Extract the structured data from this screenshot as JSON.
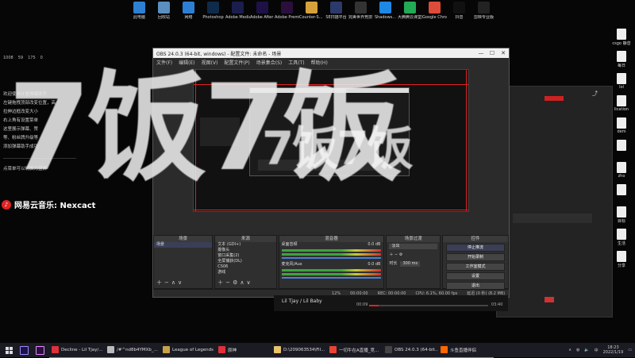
{
  "desktop_icons": [
    {
      "label": "此电脑",
      "icon": "computer-icon",
      "color": "#2d7fd3"
    },
    {
      "label": "回收站",
      "icon": "recycle-bin-icon",
      "color": "#5a8fbf"
    },
    {
      "label": "网络",
      "icon": "network-icon",
      "color": "#2d7fd3"
    },
    {
      "label": "Photoshop",
      "icon": "photoshop-icon",
      "color": "#0f2a4a"
    },
    {
      "label": "Adobe Media...",
      "icon": "media-encoder-icon",
      "color": "#1a1e4d"
    },
    {
      "label": "Adobe After Effects 2020",
      "icon": "after-effects-icon",
      "color": "#1d1147"
    },
    {
      "label": "Adobe Premie...",
      "icon": "premiere-icon",
      "color": "#2a0f3d"
    },
    {
      "label": "Counter-S... Global Off...",
      "icon": "csgo-icon",
      "color": "#d8a03c"
    },
    {
      "label": "SE扫描平台",
      "icon": "se-icon",
      "color": "#2b3a6b"
    },
    {
      "label": "完美世界竞技平台",
      "icon": "perfect-world-icon",
      "color": "#333333"
    },
    {
      "label": "Shadows...",
      "icon": "shadowsocks-icon",
      "color": "#1e88e5"
    },
    {
      "label": "大腾腾云课堂播放器",
      "icon": "player-icon",
      "color": "#22aa55"
    },
    {
      "label": "Google Chrome",
      "icon": "chrome-icon",
      "color": "#dd4b39"
    },
    {
      "label": "抖音",
      "icon": "douyin-icon",
      "color": "#111111"
    },
    {
      "label": "剪映专业版",
      "icon": "jianying-icon",
      "color": "#222222"
    }
  ],
  "right_icons": [
    {
      "label": "csgo 静音"
    },
    {
      "label": "每日"
    },
    {
      "label": "lol"
    },
    {
      "label": "lication"
    },
    {
      "label": "dem"
    },
    {
      "label": ""
    },
    {
      "label": "zho"
    },
    {
      "label": ""
    },
    {
      "label": "目标"
    },
    {
      "label": "生活"
    },
    {
      "label": "分享"
    }
  ],
  "chat": {
    "stats": [
      "1008",
      "59",
      "175",
      "0"
    ],
    "lines": [
      "欢迎使用斗鱼弹幕助手",
      "左键拖拽顶部改变位置，高",
      "拉伸边框改变大小",
      "右上角有设置菜单",
      "这里展示弹幕、赞",
      "等、粉丝牌升级等",
      "添加弹幕助手成功"
    ],
    "footer": "点菜单可以切换为竖屏"
  },
  "music_overlay": "网易云音乐: Nexcact",
  "overlay_text": [
    "7饭7饭",
    "7饭7饭"
  ],
  "obs": {
    "title": "OBS 24.0.3 (64-bit, windows) - 配置文件: 未命名 - 场景",
    "window_buttons": [
      "—",
      "☐",
      "✕"
    ],
    "menu": [
      "文件(F)",
      "编辑(E)",
      "视图(V)",
      "配置文件(P)",
      "场景集合(S)",
      "工具(T)",
      "帮助(H)"
    ],
    "docks": {
      "scenes": {
        "header": "场景",
        "items": [
          "场景"
        ]
      },
      "sources": {
        "header": "来源",
        "items": [
          "文本 (GDI+)",
          "摄像头",
          "窗口采集(2)",
          "全屏捕获(DL)",
          "CS06",
          "游戏",
          "背景"
        ]
      },
      "mixer": {
        "header": "混音器",
        "tracks": [
          "桌面音频",
          "麦克风/Aux"
        ],
        "values": [
          "0.0 dB",
          "0.0 dB"
        ]
      },
      "transitions": {
        "header": "场景过渡",
        "type": "淡出",
        "duration_label": "时长",
        "duration": "300 ms"
      },
      "controls": {
        "header": "控件",
        "buttons": [
          "停止推流",
          "开始录制",
          "工作室模式",
          "设置",
          "退出"
        ]
      }
    },
    "status": [
      "12%",
      "00:00:00",
      "REC: 00:00:00",
      "CPU: 6.1%, 60.00 fps",
      "延迟 (0 秒) (8.2 MB)"
    ]
  },
  "media": {
    "song": "Lil Tjay / Lil Baby",
    "time_start": "00:09",
    "time_end": "03:40"
  },
  "taskbar": {
    "apps": [
      {
        "label": "Decline - Lil Tjay/...",
        "color": "#e0303a"
      },
      {
        "label": "/#^nd8b4YMXb_...",
        "color": "#bbbbbb"
      },
      {
        "label": "League of Legends",
        "color": "#c8a24a"
      },
      {
        "label": "原神",
        "color": "#e0303a"
      },
      {
        "label": "D:\\209063534\\Fil...",
        "color": "#e9c46a"
      },
      {
        "label": "一切牛在A直播_竞...",
        "color": "#ea4335"
      },
      {
        "label": "OBS 24.0.3 (64-bit...",
        "color": "#444444"
      },
      {
        "label": "斗鱼直播伴侣",
        "color": "#ff6600"
      }
    ],
    "time": "18:23",
    "date": "2022/1/19"
  }
}
